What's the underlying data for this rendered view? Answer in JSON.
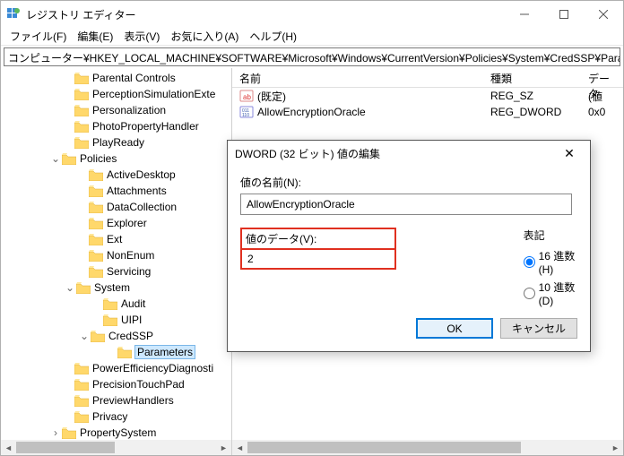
{
  "window": {
    "title": "レジストリ エディター"
  },
  "menu": {
    "file": "ファイル(F)",
    "edit": "編集(E)",
    "view": "表示(V)",
    "fav": "お気に入り(A)",
    "help": "ヘルプ(H)"
  },
  "address": "コンピューター¥HKEY_LOCAL_MACHINE¥SOFTWARE¥Microsoft¥Windows¥CurrentVersion¥Policies¥System¥CredSSP¥Parameters",
  "tree": [
    {
      "indent": 66,
      "tw": "",
      "label": "Parental Controls"
    },
    {
      "indent": 66,
      "tw": "",
      "label": "PerceptionSimulationExte"
    },
    {
      "indent": 66,
      "tw": "",
      "label": "Personalization"
    },
    {
      "indent": 66,
      "tw": "",
      "label": "PhotoPropertyHandler"
    },
    {
      "indent": 66,
      "tw": "",
      "label": "PlayReady"
    },
    {
      "indent": 52,
      "tw": "⌄",
      "label": "Policies"
    },
    {
      "indent": 82,
      "tw": "",
      "label": "ActiveDesktop"
    },
    {
      "indent": 82,
      "tw": "",
      "label": "Attachments"
    },
    {
      "indent": 82,
      "tw": "",
      "label": "DataCollection"
    },
    {
      "indent": 82,
      "tw": "",
      "label": "Explorer"
    },
    {
      "indent": 82,
      "tw": "",
      "label": "Ext"
    },
    {
      "indent": 82,
      "tw": "",
      "label": "NonEnum"
    },
    {
      "indent": 82,
      "tw": "",
      "label": "Servicing"
    },
    {
      "indent": 68,
      "tw": "⌄",
      "label": "System"
    },
    {
      "indent": 98,
      "tw": "",
      "label": "Audit"
    },
    {
      "indent": 98,
      "tw": "",
      "label": "UIPI"
    },
    {
      "indent": 84,
      "tw": "⌄",
      "label": "CredSSP"
    },
    {
      "indent": 114,
      "tw": "",
      "label": "Parameters",
      "selected": true
    },
    {
      "indent": 66,
      "tw": "",
      "label": "PowerEfficiencyDiagnosti"
    },
    {
      "indent": 66,
      "tw": "",
      "label": "PrecisionTouchPad"
    },
    {
      "indent": 66,
      "tw": "",
      "label": "PreviewHandlers"
    },
    {
      "indent": 66,
      "tw": "",
      "label": "Privacy"
    },
    {
      "indent": 52,
      "tw": "›",
      "label": "PropertySystem"
    }
  ],
  "list": {
    "headers": {
      "name": "名前",
      "type": "種類",
      "data": "データ"
    },
    "rows": [
      {
        "icon": "str",
        "name": "(既定)",
        "type": "REG_SZ",
        "data": "(値"
      },
      {
        "icon": "bin",
        "name": "AllowEncryptionOracle",
        "type": "REG_DWORD",
        "data": "0x0"
      }
    ]
  },
  "dialog": {
    "title": "DWORD (32 ビット) 値の編集",
    "name_label": "値の名前(N):",
    "name_value": "AllowEncryptionOracle",
    "data_label": "値のデータ(V):",
    "data_value": "2",
    "base_label": "表記",
    "hex": "16 進数(H)",
    "dec": "10 進数(D)",
    "ok": "OK",
    "cancel": "キャンセル"
  }
}
